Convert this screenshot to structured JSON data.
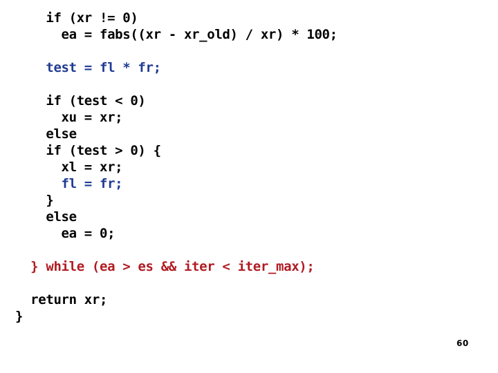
{
  "slide": {
    "background_color": "#ffffff",
    "page_number": "60",
    "colors": {
      "default_text": "#000000",
      "blue_text": "#1f3a93",
      "red_text": "#b01b22"
    },
    "code_lines": [
      {
        "text": "    if (xr != 0)",
        "color": "black"
      },
      {
        "text": "      ea = fabs((xr - xr_old) / xr) * 100;",
        "color": "black"
      },
      {
        "text": "",
        "color": "black"
      },
      {
        "text": "    test = fl * fr;",
        "color": "blue"
      },
      {
        "text": "",
        "color": "black"
      },
      {
        "text": "    if (test < 0)",
        "color": "black"
      },
      {
        "text": "      xu = xr;",
        "color": "black"
      },
      {
        "text": "    else",
        "color": "black"
      },
      {
        "text": "    if (test > 0) {",
        "color": "black"
      },
      {
        "text": "      xl = xr;",
        "color": "black"
      },
      {
        "text": "      fl = fr;",
        "color": "blue"
      },
      {
        "text": "    }",
        "color": "black"
      },
      {
        "text": "    else",
        "color": "black"
      },
      {
        "text": "      ea = 0;",
        "color": "black"
      },
      {
        "text": "",
        "color": "black"
      },
      {
        "text": "  } while (ea > es && iter < iter_max);",
        "color": "red"
      },
      {
        "text": "",
        "color": "black"
      },
      {
        "text": "  return xr;",
        "color": "black"
      },
      {
        "text": "}",
        "color": "black"
      }
    ]
  }
}
